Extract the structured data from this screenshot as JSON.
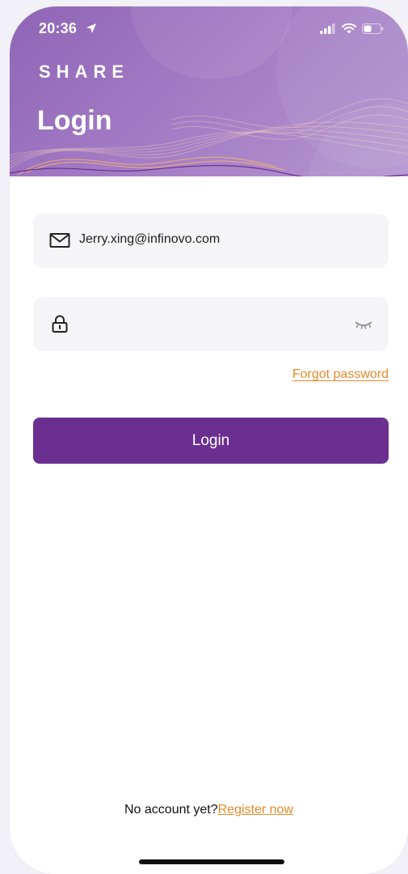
{
  "status_bar": {
    "time": "20:36",
    "icons": [
      "location-arrow-icon",
      "cellular-signal-icon",
      "wifi-icon",
      "battery-icon"
    ]
  },
  "header": {
    "brand": "SHARE",
    "title": "Login"
  },
  "email_field": {
    "icon": "mail-icon",
    "value": "Jerry.xing@infinovo.com"
  },
  "password_field": {
    "icon": "lock-icon",
    "value": "",
    "toggle_icon": "eye-closed-icon"
  },
  "forgot_password": "Forgot password",
  "login_button": "Login",
  "footer": {
    "prompt": "No account yet?",
    "register_link": "Register now"
  },
  "colors": {
    "header_gradient_start": "#8f65b6",
    "header_gradient_end": "#b596cf",
    "primary": "#6a2f90",
    "link": "#e88a2a",
    "field_bg": "#f5f5f7"
  }
}
